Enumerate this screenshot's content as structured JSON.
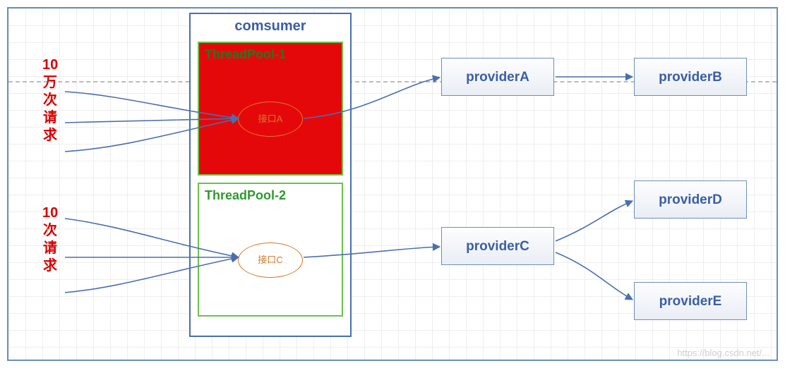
{
  "labels": {
    "top": {
      "l1": "10",
      "l2": "万",
      "l3": "次",
      "l4": "请",
      "l5": "求"
    },
    "bot": {
      "l1": "10",
      "l2": "次",
      "l3": "请",
      "l4": "求"
    }
  },
  "consumer": {
    "title": "comsumer",
    "pool1": {
      "title": "ThreadPool-1",
      "iface": "接口A"
    },
    "pool2": {
      "title": "ThreadPool-2",
      "iface": "接口C"
    }
  },
  "providers": {
    "a": "providerA",
    "b": "providerB",
    "c": "providerC",
    "d": "providerD",
    "e": "providerE"
  },
  "watermark": "https://blog.csdn.net/..."
}
